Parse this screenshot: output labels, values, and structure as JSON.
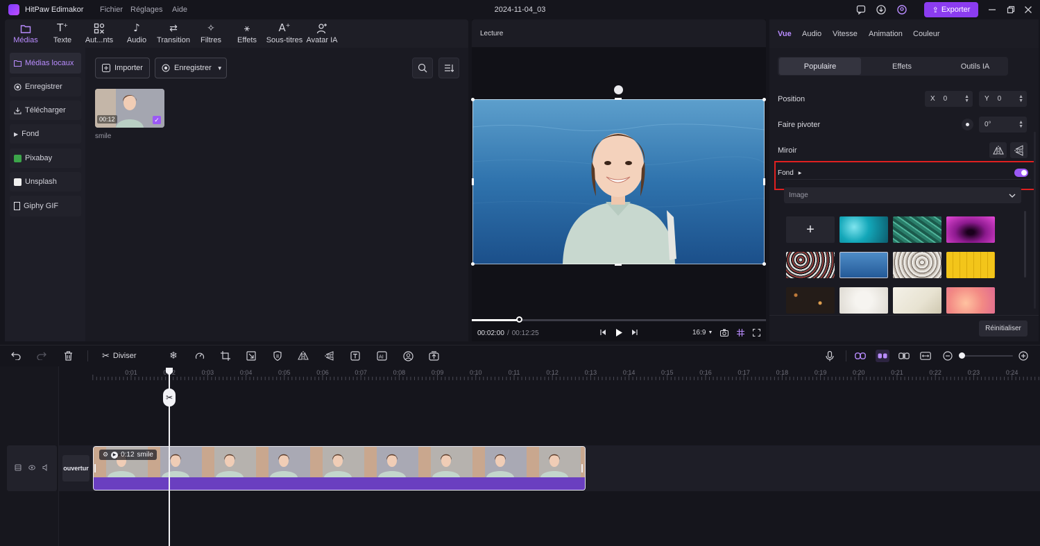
{
  "titlebar": {
    "app_name": "HitPaw Edimakor",
    "menu": [
      "Fichier",
      "Réglages",
      "Aide"
    ],
    "project_name": "2024-11-04_03",
    "export_label": "Exporter"
  },
  "tools": [
    "Médias",
    "Texte",
    "Aut...nts",
    "Audio",
    "Transition",
    "Filtres",
    "Effets",
    "Sous-titres",
    "Avatar IA"
  ],
  "sidebar": [
    "Médias locaux",
    "Enregistrer",
    "Télécharger",
    "Fond",
    "Pixabay",
    "Unsplash",
    "Giphy GIF"
  ],
  "media": {
    "import_label": "Importer",
    "record_label": "Enregistrer",
    "item_duration": "00:12",
    "item_name": "smile"
  },
  "preview": {
    "title": "Lecture",
    "current_time": "00:02:00",
    "separator": "/",
    "total_time": "00:12:25",
    "aspect_ratio": "16:9",
    "progress_fraction": 0.16
  },
  "right_panel": {
    "tabs": [
      "Vue",
      "Audio",
      "Vitesse",
      "Animation",
      "Couleur"
    ],
    "segments": [
      "Populaire",
      "Effets",
      "Outils IA"
    ],
    "position_label": "Position",
    "x_label": "X",
    "x_value": "0",
    "y_label": "Y",
    "y_value": "0",
    "rotate_label": "Faire pivoter",
    "rotate_value": "0°",
    "mirror_label": "Miroir",
    "background_label": "Fond",
    "background_enabled": true,
    "background_type": "Image",
    "reset_label": "Réinitialiser",
    "add_symbol": "+"
  },
  "timeline_toolbar": {
    "split_label": "Diviser"
  },
  "ruler_ticks": [
    "0:01",
    "0:02",
    "0:03",
    "0:04",
    "0:05",
    "0:06",
    "0:07",
    "0:08",
    "0:09",
    "0:10",
    "0:11",
    "0:12",
    "0:13",
    "0:14",
    "0:15",
    "0:16",
    "0:17",
    "0:18",
    "0:19",
    "0:20",
    "0:21",
    "0:22",
    "0:23",
    "0:24"
  ],
  "track": {
    "cover_label": "ouvertur",
    "clip_duration": "0:12",
    "clip_name": "smile"
  },
  "colors": {
    "accent": "#8b3cf0",
    "highlight_border": "#e02020",
    "clip_audio": "#6a3fc0"
  }
}
